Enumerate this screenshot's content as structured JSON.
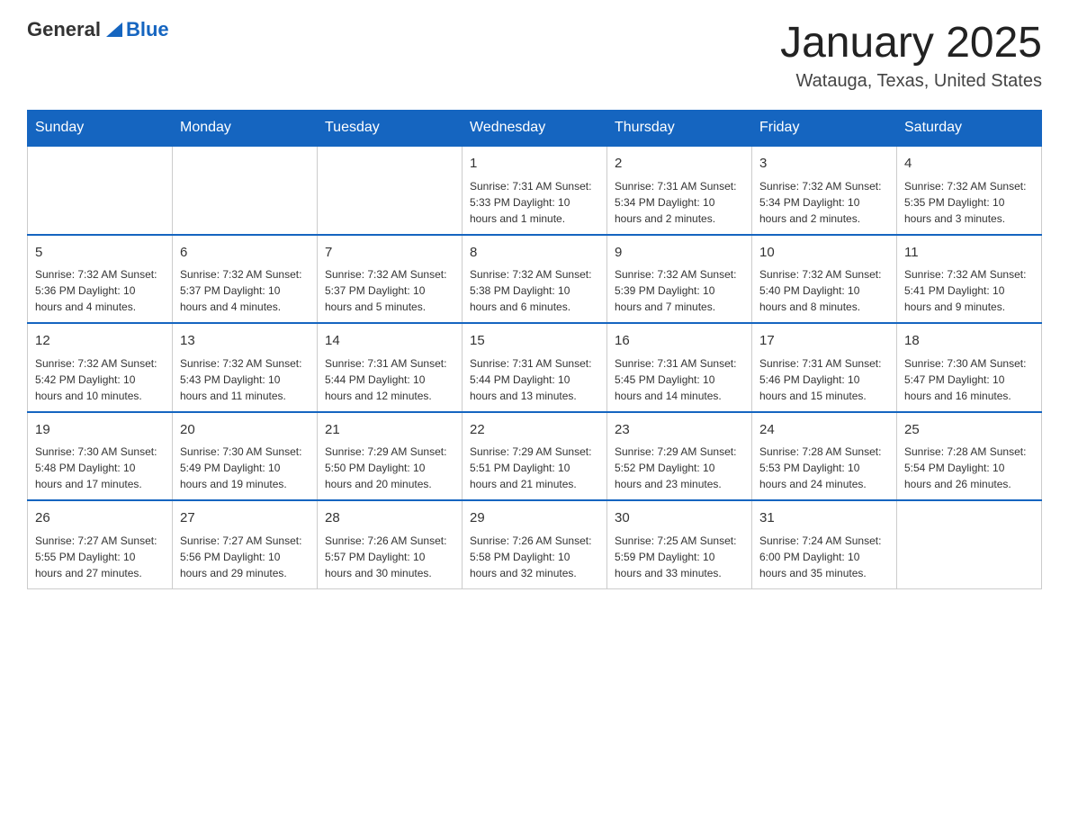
{
  "header": {
    "logo_general": "General",
    "logo_blue": "Blue",
    "month": "January 2025",
    "location": "Watauga, Texas, United States"
  },
  "days_of_week": [
    "Sunday",
    "Monday",
    "Tuesday",
    "Wednesday",
    "Thursday",
    "Friday",
    "Saturday"
  ],
  "weeks": [
    [
      {
        "day": "",
        "info": ""
      },
      {
        "day": "",
        "info": ""
      },
      {
        "day": "",
        "info": ""
      },
      {
        "day": "1",
        "info": "Sunrise: 7:31 AM\nSunset: 5:33 PM\nDaylight: 10 hours and 1 minute."
      },
      {
        "day": "2",
        "info": "Sunrise: 7:31 AM\nSunset: 5:34 PM\nDaylight: 10 hours and 2 minutes."
      },
      {
        "day": "3",
        "info": "Sunrise: 7:32 AM\nSunset: 5:34 PM\nDaylight: 10 hours and 2 minutes."
      },
      {
        "day": "4",
        "info": "Sunrise: 7:32 AM\nSunset: 5:35 PM\nDaylight: 10 hours and 3 minutes."
      }
    ],
    [
      {
        "day": "5",
        "info": "Sunrise: 7:32 AM\nSunset: 5:36 PM\nDaylight: 10 hours and 4 minutes."
      },
      {
        "day": "6",
        "info": "Sunrise: 7:32 AM\nSunset: 5:37 PM\nDaylight: 10 hours and 4 minutes."
      },
      {
        "day": "7",
        "info": "Sunrise: 7:32 AM\nSunset: 5:37 PM\nDaylight: 10 hours and 5 minutes."
      },
      {
        "day": "8",
        "info": "Sunrise: 7:32 AM\nSunset: 5:38 PM\nDaylight: 10 hours and 6 minutes."
      },
      {
        "day": "9",
        "info": "Sunrise: 7:32 AM\nSunset: 5:39 PM\nDaylight: 10 hours and 7 minutes."
      },
      {
        "day": "10",
        "info": "Sunrise: 7:32 AM\nSunset: 5:40 PM\nDaylight: 10 hours and 8 minutes."
      },
      {
        "day": "11",
        "info": "Sunrise: 7:32 AM\nSunset: 5:41 PM\nDaylight: 10 hours and 9 minutes."
      }
    ],
    [
      {
        "day": "12",
        "info": "Sunrise: 7:32 AM\nSunset: 5:42 PM\nDaylight: 10 hours and 10 minutes."
      },
      {
        "day": "13",
        "info": "Sunrise: 7:32 AM\nSunset: 5:43 PM\nDaylight: 10 hours and 11 minutes."
      },
      {
        "day": "14",
        "info": "Sunrise: 7:31 AM\nSunset: 5:44 PM\nDaylight: 10 hours and 12 minutes."
      },
      {
        "day": "15",
        "info": "Sunrise: 7:31 AM\nSunset: 5:44 PM\nDaylight: 10 hours and 13 minutes."
      },
      {
        "day": "16",
        "info": "Sunrise: 7:31 AM\nSunset: 5:45 PM\nDaylight: 10 hours and 14 minutes."
      },
      {
        "day": "17",
        "info": "Sunrise: 7:31 AM\nSunset: 5:46 PM\nDaylight: 10 hours and 15 minutes."
      },
      {
        "day": "18",
        "info": "Sunrise: 7:30 AM\nSunset: 5:47 PM\nDaylight: 10 hours and 16 minutes."
      }
    ],
    [
      {
        "day": "19",
        "info": "Sunrise: 7:30 AM\nSunset: 5:48 PM\nDaylight: 10 hours and 17 minutes."
      },
      {
        "day": "20",
        "info": "Sunrise: 7:30 AM\nSunset: 5:49 PM\nDaylight: 10 hours and 19 minutes."
      },
      {
        "day": "21",
        "info": "Sunrise: 7:29 AM\nSunset: 5:50 PM\nDaylight: 10 hours and 20 minutes."
      },
      {
        "day": "22",
        "info": "Sunrise: 7:29 AM\nSunset: 5:51 PM\nDaylight: 10 hours and 21 minutes."
      },
      {
        "day": "23",
        "info": "Sunrise: 7:29 AM\nSunset: 5:52 PM\nDaylight: 10 hours and 23 minutes."
      },
      {
        "day": "24",
        "info": "Sunrise: 7:28 AM\nSunset: 5:53 PM\nDaylight: 10 hours and 24 minutes."
      },
      {
        "day": "25",
        "info": "Sunrise: 7:28 AM\nSunset: 5:54 PM\nDaylight: 10 hours and 26 minutes."
      }
    ],
    [
      {
        "day": "26",
        "info": "Sunrise: 7:27 AM\nSunset: 5:55 PM\nDaylight: 10 hours and 27 minutes."
      },
      {
        "day": "27",
        "info": "Sunrise: 7:27 AM\nSunset: 5:56 PM\nDaylight: 10 hours and 29 minutes."
      },
      {
        "day": "28",
        "info": "Sunrise: 7:26 AM\nSunset: 5:57 PM\nDaylight: 10 hours and 30 minutes."
      },
      {
        "day": "29",
        "info": "Sunrise: 7:26 AM\nSunset: 5:58 PM\nDaylight: 10 hours and 32 minutes."
      },
      {
        "day": "30",
        "info": "Sunrise: 7:25 AM\nSunset: 5:59 PM\nDaylight: 10 hours and 33 minutes."
      },
      {
        "day": "31",
        "info": "Sunrise: 7:24 AM\nSunset: 6:00 PM\nDaylight: 10 hours and 35 minutes."
      },
      {
        "day": "",
        "info": ""
      }
    ]
  ]
}
